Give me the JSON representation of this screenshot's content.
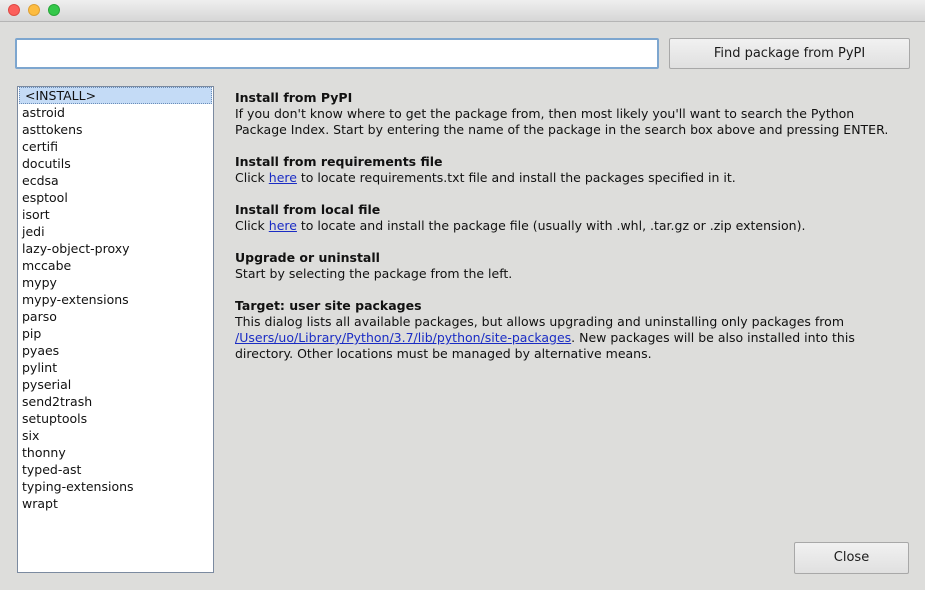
{
  "search": {
    "value": "",
    "button_label": "Find package from PyPI"
  },
  "packages": [
    "<INSTALL>",
    "astroid",
    "asttokens",
    "certifi",
    "docutils",
    "ecdsa",
    "esptool",
    "isort",
    "jedi",
    "lazy-object-proxy",
    "mccabe",
    "mypy",
    "mypy-extensions",
    "parso",
    "pip",
    "pyaes",
    "pylint",
    "pyserial",
    "send2trash",
    "setuptools",
    "six",
    "thonny",
    "typed-ast",
    "typing-extensions",
    "wrapt"
  ],
  "selected_package": "<INSTALL>",
  "info": {
    "pypi": {
      "title": "Install from PyPI",
      "line1": "If you don't know where to get the package from, then most likely you'll want to search the Python",
      "line2": "Package Index. Start by entering the name of the package in the search box above and pressing ENTER."
    },
    "requirements": {
      "title": "Install from requirements file",
      "before": "Click ",
      "link": "here",
      "after": " to locate requirements.txt file and install the packages specified in it."
    },
    "local": {
      "title": "Install from local file",
      "before": "Click ",
      "link": "here",
      "after": " to locate and install the package file (usually with .whl, .tar.gz or .zip extension)."
    },
    "upgrade": {
      "title": "Upgrade or uninstall",
      "text": "Start by selecting the package from the left."
    },
    "target": {
      "title": "Target:  user site packages",
      "line1": "This dialog lists all available packages, but allows upgrading and uninstalling only packages from",
      "link": "/Users/uo/Library/Python/3.7/lib/python/site-packages",
      "after_link": ". New packages will be also installed into this",
      "line3": "directory. Other locations must be managed by alternative means."
    }
  },
  "close_label": "Close"
}
